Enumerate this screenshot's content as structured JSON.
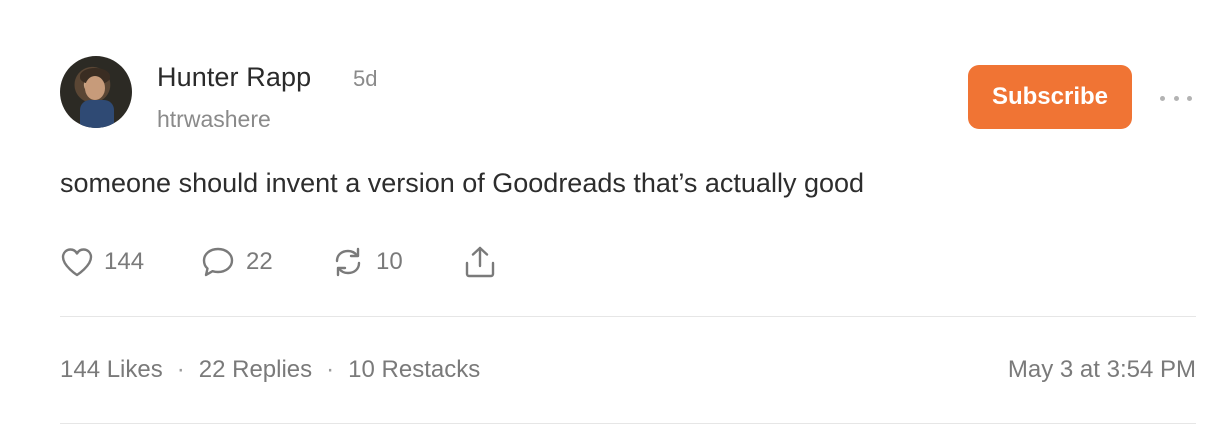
{
  "post": {
    "author_name": "Hunter Rapp",
    "time_ago": "5d",
    "handle": "htrwashere",
    "subscribe_label": "Subscribe",
    "text": "someone should invent a version of Goodreads that’s actually good",
    "timestamp": "May 3 at 3:54 PM"
  },
  "actions": {
    "likes": "144",
    "comments": "22",
    "restacks": "10"
  },
  "stats": {
    "likes": "144 Likes",
    "replies": "22 Replies",
    "restacks": "10 Restacks",
    "separator": "·"
  },
  "icons": {
    "like": "heart-icon",
    "comment": "comment-icon",
    "restack": "restack-icon",
    "share": "share-icon",
    "more": "more-icon"
  },
  "colors": {
    "accent": "#f07434",
    "muted_text": "#7a7a7a"
  }
}
